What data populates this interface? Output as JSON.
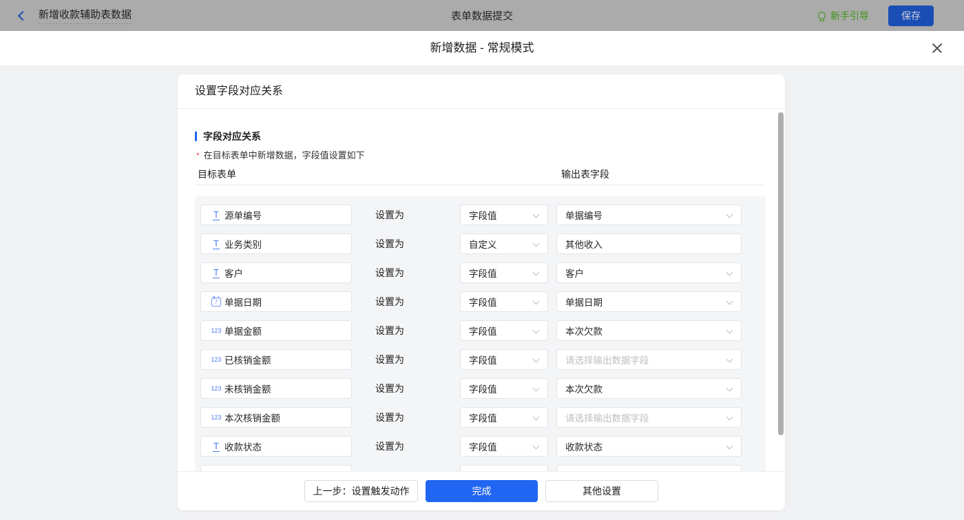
{
  "topbar": {
    "workflow_title": "新增收款辅助表数据",
    "center_title": "表单数据提交",
    "guide_label": "新手引导",
    "save_label": "保存"
  },
  "modal": {
    "title": "新增数据 - 常规模式",
    "card": {
      "header": "设置字段对应关系",
      "section_title": "字段对应关系",
      "description": "在目标表单中新增数据，字段值设置如下",
      "required_mark": "*",
      "col_target": "目标表单",
      "col_output": "输出表字段",
      "set_as_label": "设置为",
      "rows": [
        {
          "type": "text",
          "icon": "T",
          "field": "源单编号",
          "mode": "字段值",
          "output": "单据编号",
          "output_type": "select"
        },
        {
          "type": "text",
          "icon": "T",
          "field": "业务类别",
          "mode": "自定义",
          "output": "其他收入",
          "output_type": "input"
        },
        {
          "type": "text",
          "icon": "T",
          "field": "客户",
          "mode": "字段值",
          "output": "客户",
          "output_type": "select"
        },
        {
          "type": "date",
          "icon": "7",
          "field": "单据日期",
          "mode": "字段值",
          "output": "单据日期",
          "output_type": "select"
        },
        {
          "type": "number",
          "icon": "123",
          "field": "单据金额",
          "mode": "字段值",
          "output": "本次欠款",
          "output_type": "select"
        },
        {
          "type": "number",
          "icon": "123",
          "field": "已核销金额",
          "mode": "字段值",
          "output": "请选择输出数据字段",
          "output_type": "select",
          "output_placeholder": true
        },
        {
          "type": "number",
          "icon": "123",
          "field": "未核销金额",
          "mode": "字段值",
          "output": "本次欠款",
          "output_type": "select"
        },
        {
          "type": "number",
          "icon": "123",
          "field": "本次核销金额",
          "mode": "字段值",
          "output": "请选择输出数据字段",
          "output_type": "select",
          "output_placeholder": true
        },
        {
          "type": "text",
          "icon": "T",
          "field": "收款状态",
          "mode": "字段值",
          "output": "收款状态",
          "output_type": "select"
        },
        {
          "type": "",
          "icon": "",
          "field": "",
          "mode": "",
          "output": "",
          "output_type": "select",
          "partial": true
        }
      ]
    },
    "footer": {
      "prev_label": "上一步：设置触发动作",
      "done_label": "完成",
      "other_label": "其他设置"
    }
  },
  "colors": {
    "accent_blue": "#2166f2",
    "guide_green": "#3d9313",
    "asterisk_red": "#e0485a",
    "topbar_bg": "#ababab",
    "save_button_bg": "#1b4eb5"
  }
}
